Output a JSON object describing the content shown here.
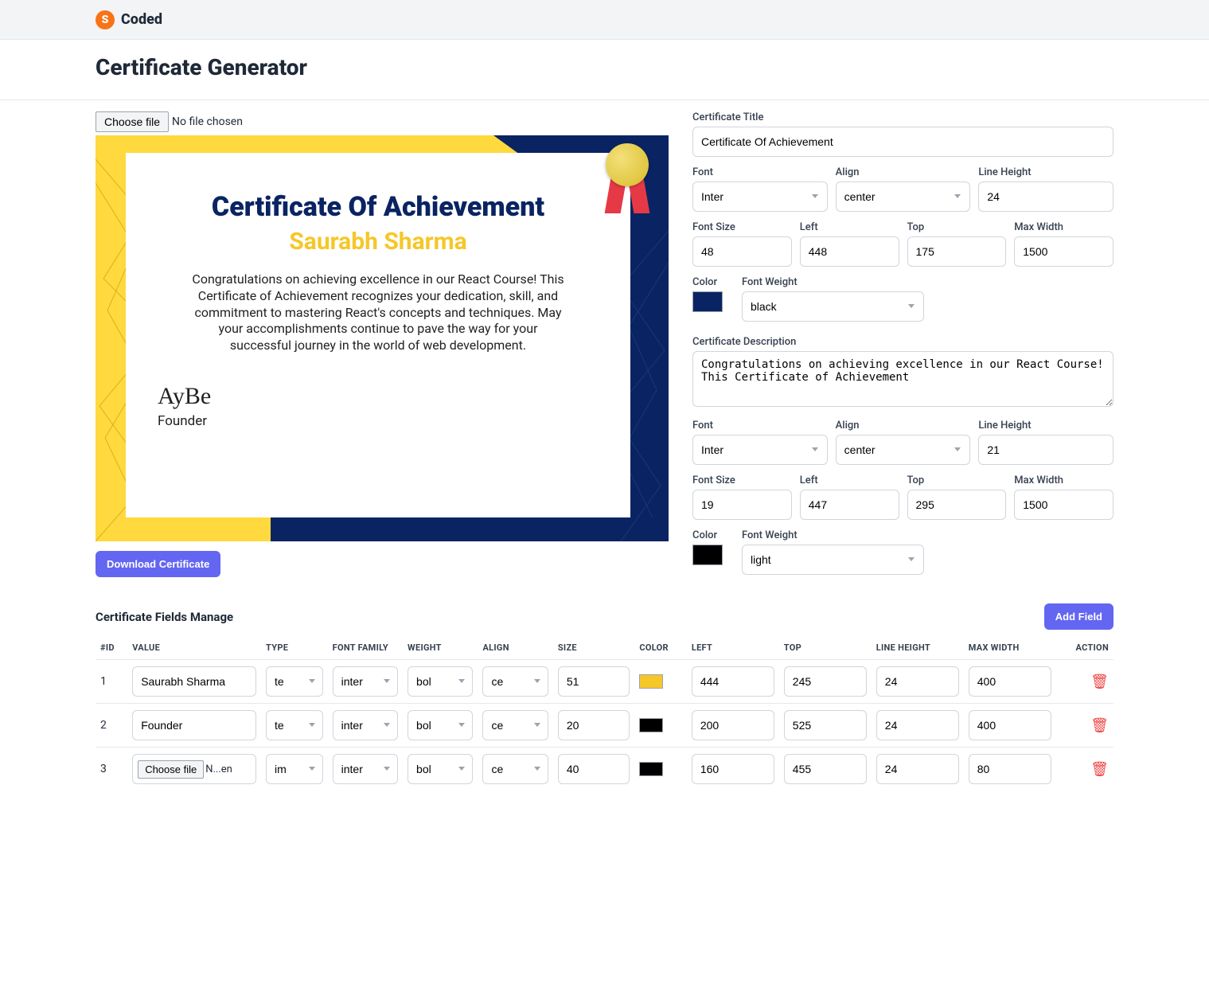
{
  "brand": {
    "logo_letter": "S",
    "name": "Coded"
  },
  "page_title": "Certificate Generator",
  "file_picker": {
    "button": "Choose file",
    "status": "No file chosen"
  },
  "certificate_preview": {
    "title": "Certificate Of Achievement",
    "name": "Saurabh Sharma",
    "description": "Congratulations on achieving excellence in our React Course! This Certificate of Achievement recognizes your dedication, skill, and commitment to mastering React's concepts and techniques. May your accomplishments continue to pave the way for your successful journey in the world of web development.",
    "signature": "AyBe",
    "role": "Founder"
  },
  "download_button": "Download Certificate",
  "title_form": {
    "label": "Certificate Title",
    "value": "Certificate Of Achievement",
    "font_label": "Font",
    "font": "Inter",
    "align_label": "Align",
    "align": "center",
    "line_height_label": "Line Height",
    "line_height": "24",
    "font_size_label": "Font Size",
    "font_size": "48",
    "left_label": "Left",
    "left": "448",
    "top_label": "Top",
    "top": "175",
    "max_width_label": "Max Width",
    "max_width": "1500",
    "color_label": "Color",
    "color": "#0a2463",
    "font_weight_label": "Font Weight",
    "font_weight": "black"
  },
  "desc_form": {
    "label": "Certificate Description",
    "value": "Congratulations on achieving excellence in our React Course! This Certificate of Achievement",
    "font_label": "Font",
    "font": "Inter",
    "align_label": "Align",
    "align": "center",
    "line_height_label": "Line Height",
    "line_height": "21",
    "font_size_label": "Font Size",
    "font_size": "19",
    "left_label": "Left",
    "left": "447",
    "top_label": "Top",
    "top": "295",
    "max_width_label": "Max Width",
    "max_width": "1500",
    "color_label": "Color",
    "color": "#000000",
    "font_weight_label": "Font Weight",
    "font_weight": "light"
  },
  "fields_section": {
    "title": "Certificate Fields Manage",
    "add_button": "Add Field"
  },
  "table": {
    "headers": {
      "id": "#ID",
      "value": "VALUE",
      "type": "TYPE",
      "font_family": "FONT FAMILY",
      "weight": "WEIGHT",
      "align": "ALIGN",
      "size": "SIZE",
      "color": "COLOR",
      "left": "LEFT",
      "top": "TOP",
      "line_height": "LINE HEIGHT",
      "max_width": "MAX WIDTH",
      "action": "ACTION"
    },
    "rows": [
      {
        "id": "1",
        "value": "Saurabh Sharma",
        "type": "text",
        "font_family": "inter",
        "weight": "bold",
        "align": "center",
        "size": "51",
        "color": "#f5c728",
        "left": "444",
        "top": "245",
        "line_height": "24",
        "max_width": "400",
        "is_file": false
      },
      {
        "id": "2",
        "value": "Founder",
        "type": "text",
        "font_family": "inter",
        "weight": "bold",
        "align": "center",
        "size": "20",
        "color": "#000000",
        "left": "200",
        "top": "525",
        "line_height": "24",
        "max_width": "400",
        "is_file": false
      },
      {
        "id": "3",
        "value": "",
        "file_button": "Choose file",
        "file_status": "N...en",
        "type": "image",
        "font_family": "inter",
        "weight": "bold",
        "align": "center",
        "size": "40",
        "color": "#000000",
        "left": "160",
        "top": "455",
        "line_height": "24",
        "max_width": "80",
        "is_file": true
      }
    ]
  }
}
